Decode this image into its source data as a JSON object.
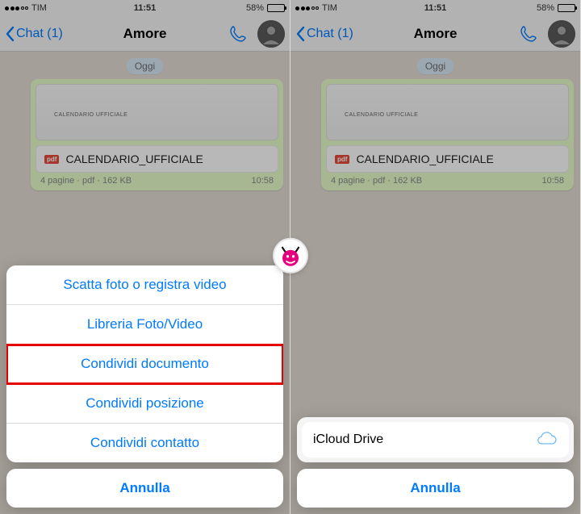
{
  "status": {
    "carrier": "TIM",
    "time": "11:51",
    "battery": "58%"
  },
  "nav": {
    "back": "Chat (1)",
    "title": "Amore"
  },
  "chat": {
    "date": "Oggi",
    "doc_thumb_title": "CALENDARIO UFFICIALE",
    "pdf_badge": "pdf",
    "doc_filename": "CALENDARIO_UFFICIALE",
    "doc_meta": "4 pagine · pdf · 162 KB",
    "doc_time": "10:58"
  },
  "sheet": {
    "items": [
      "Scatta foto o registra video",
      "Libreria Foto/Video",
      "Condividi documento",
      "Condividi posizione",
      "Condividi contatto"
    ],
    "cancel": "Annulla"
  },
  "drive": {
    "label": "iCloud Drive",
    "cancel": "Annulla"
  }
}
